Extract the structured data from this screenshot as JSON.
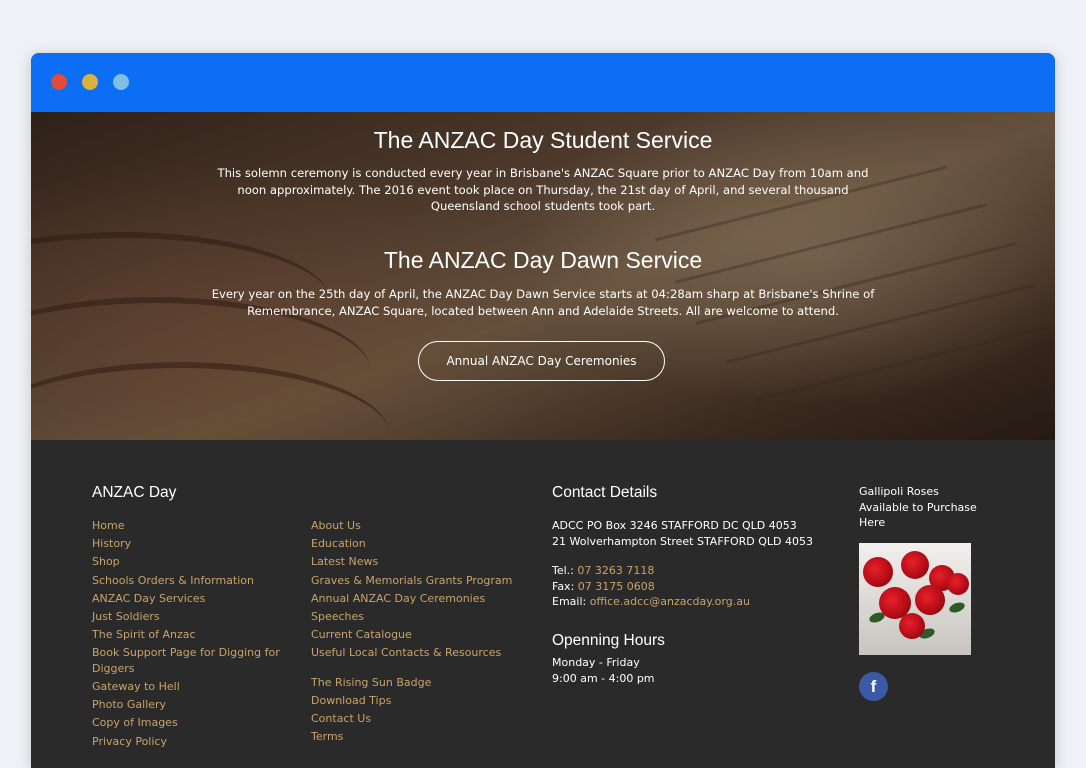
{
  "hero": {
    "student_title": "The ANZAC Day Student Service",
    "student_text": "This solemn ceremony is conducted every year in Brisbane's ANZAC Square prior to ANZAC Day from 10am and noon approximately. The 2016 event took place on Thursday, the 21st day of April, and several thousand Queensland school students took part.",
    "dawn_title": "The ANZAC Day Dawn Service",
    "dawn_text": "Every year on the 25th day of April, the ANZAC Day Dawn Service starts at 04:28am sharp at Brisbane's Shrine of Remembrance, ANZAC Square, located between Ann and Adelaide Streets. All are welcome to attend.",
    "button_label": "Annual ANZAC Day Ceremonies"
  },
  "footer": {
    "col1_title": "ANZAC Day",
    "links_col1": [
      "Home",
      "History",
      "Shop",
      "Schools Orders & Information",
      "ANZAC Day Services",
      "Just Soldiers",
      "The Spirit of Anzac",
      "Book Support Page for Digging for Diggers",
      "Gateway to Hell",
      "Photo Gallery",
      "Copy of Images",
      "Privacy Policy"
    ],
    "links_col2": [
      "About Us",
      "Education",
      "Latest News",
      "Graves & Memorials Grants Program",
      "Annual ANZAC Day Ceremonies",
      "Speeches",
      "Current Catalogue",
      "Useful Local Contacts & Resources",
      "The Rising Sun Badge",
      "Download Tips",
      "Contact Us",
      "Terms"
    ],
    "contact_title": "Contact Details",
    "address_line1": "ADCC PO Box 3246 STAFFORD DC QLD 4053",
    "address_line2": "21 Wolverhampton Street STAFFORD QLD 4053",
    "tel_label": "Tel.:",
    "tel": "07 3263 7118",
    "fax_label": "Fax:",
    "fax": "07 3175 0608",
    "email_label": "Email:",
    "email": "office.adcc@anzacday.org.au",
    "hours_title": "Openning Hours",
    "hours_days": "Monday - Friday",
    "hours_time": "9:00 am - 4:00 pm",
    "roses_text": "Gallipoli Roses Available to Purchase Here",
    "facebook_icon": "f"
  },
  "colors": {
    "titlebar": "#0b6ef5",
    "link": "#c9a36a",
    "footer_bg": "#2a2a2a"
  }
}
